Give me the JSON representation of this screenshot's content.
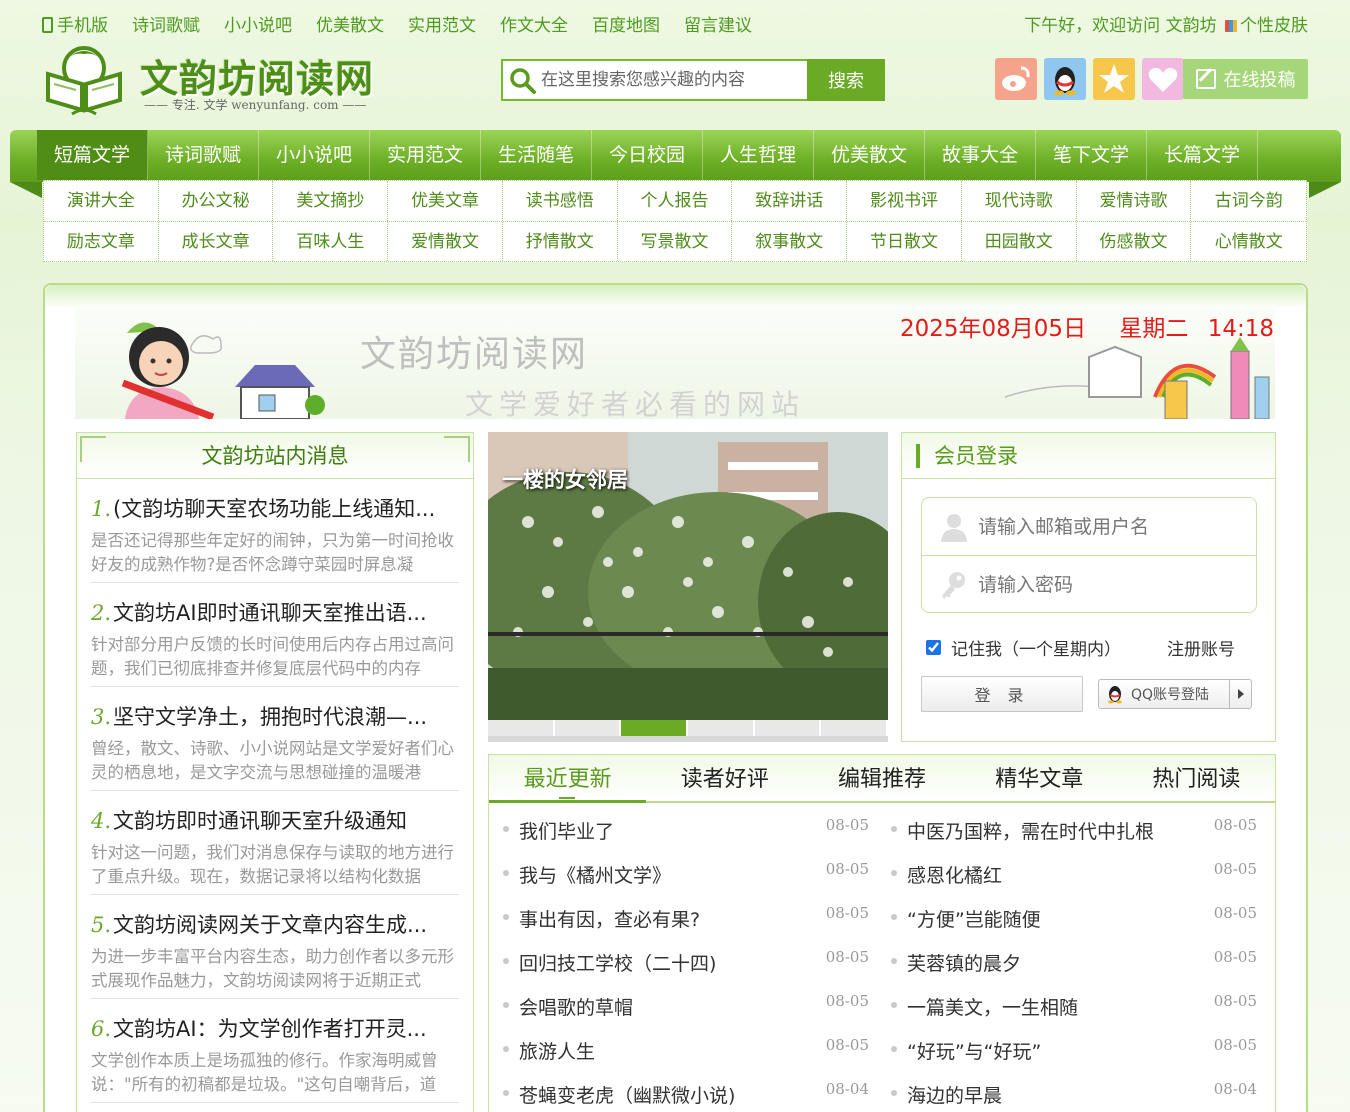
{
  "topbar": {
    "links": [
      "手机版",
      "诗词歌赋",
      "小小说吧",
      "优美散文",
      "实用范文",
      "作文大全",
      "百度地图",
      "留言建议"
    ],
    "welcome": "下午好，欢迎访问 文韵坊",
    "skin": "个性皮肤"
  },
  "logo": {
    "title": "文韵坊阅读网",
    "slogan": "—— 专注. 文学 wenyunfang. com ——"
  },
  "search": {
    "placeholder": "在这里搜索您感兴趣的内容",
    "button": "搜索"
  },
  "socials": [
    "weibo-icon",
    "qq-icon",
    "qzone-icon",
    "heart-icon"
  ],
  "submit_label": "在线投稿",
  "mainnav": [
    "短篇文学",
    "诗词歌赋",
    "小小说吧",
    "实用范文",
    "生活随笔",
    "今日校园",
    "人生哲理",
    "优美散文",
    "故事大全",
    "笔下文学",
    "长篇文学"
  ],
  "subnav": {
    "row1": [
      "演讲大全",
      "办公文秘",
      "美文摘抄",
      "优美文章",
      "读书感悟",
      "个人报告",
      "致辞讲话",
      "影视书评",
      "现代诗歌",
      "爱情诗歌",
      "古词今韵"
    ],
    "row2": [
      "励志文章",
      "成长文章",
      "百味人生",
      "爱情散文",
      "抒情散文",
      "写景散文",
      "叙事散文",
      "节日散文",
      "田园散文",
      "伤感散文",
      "心情散文"
    ]
  },
  "banner": {
    "title": "文韵坊阅读网",
    "subtitle": "文学爱好者必看的网站",
    "date": "2025年08月05日",
    "weekday": "星期二",
    "time": "14:18:42"
  },
  "news": {
    "title": "文韵坊站内消息",
    "items": [
      {
        "num": "1.",
        "title": "(文韵坊聊天室农场功能上线通知...",
        "desc": "是否还记得那些年定好的闹钟，只为第一时间抢收好友的成熟作物?是否怀念蹲守菜园时屏息凝"
      },
      {
        "num": "2.",
        "title": "文韵坊AI即时通讯聊天室推出语...",
        "desc": "针对部分用户反馈的长时间使用后内存占用过高问题，我们已彻底排查并修复底层代码中的内存"
      },
      {
        "num": "3.",
        "title": "坚守文学净土，拥抱时代浪潮—...",
        "desc": "曾经，散文、诗歌、小小说网站是文学爱好者们心灵的栖息地，是文字交流与思想碰撞的温暖港"
      },
      {
        "num": "4.",
        "title": "文韵坊即时通讯聊天室升级通知",
        "desc": "针对这一问题，我们对消息保存与读取的地方进行了重点升级。现在，数据记录将以结构化数据"
      },
      {
        "num": "5.",
        "title": "文韵坊阅读网关于文章内容生成...",
        "desc": "为进一步丰富平台内容生态，助力创作者以多元形式展现作品魅力，文韵坊阅读网将于近期正式"
      },
      {
        "num": "6.",
        "title": "文韵坊AI：为文学创作者打开灵...",
        "desc": "文学创作本质上是场孤独的修行。作家海明威曾说：\"所有的初稿都是垃圾。\"这句自嘲背后，道"
      }
    ]
  },
  "slide": {
    "caption": "一楼的女邻居",
    "count": 6,
    "active": 3
  },
  "login": {
    "title": "会员登录",
    "user_placeholder": "请输入邮箱或用户名",
    "pass_placeholder": "请输入密码",
    "remember": "记住我（一个星期内）",
    "register": "注册账号",
    "login_button": "登 录",
    "qq_button": "QQ账号登陆"
  },
  "tabs": [
    "最近更新",
    "读者好评",
    "编辑推荐",
    "精华文章",
    "热门阅读"
  ],
  "articles": {
    "left": [
      {
        "title": "我们毕业了",
        "date": "08-05"
      },
      {
        "title": "我与《橘州文学》",
        "date": "08-05"
      },
      {
        "title": "事出有因，查必有果?",
        "date": "08-05"
      },
      {
        "title": "回归技工学校（二十四)",
        "date": "08-05"
      },
      {
        "title": "会唱歌的草帽",
        "date": "08-05"
      },
      {
        "title": "旅游人生",
        "date": "08-05"
      },
      {
        "title": "苍蝇变老虎（幽默微小说)",
        "date": "08-04"
      }
    ],
    "right": [
      {
        "title": "中医乃国粹，需在时代中扎根",
        "date": "08-05"
      },
      {
        "title": "感恩化橘红",
        "date": "08-05"
      },
      {
        "title": "“方便”岂能随便",
        "date": "08-05"
      },
      {
        "title": "芙蓉镇的晨夕",
        "date": "08-05"
      },
      {
        "title": "一篇美文，一生相随",
        "date": "08-05"
      },
      {
        "title": "“好玩”与“好玩”",
        "date": "08-05"
      },
      {
        "title": "海边的早晨",
        "date": "08-04"
      }
    ]
  }
}
